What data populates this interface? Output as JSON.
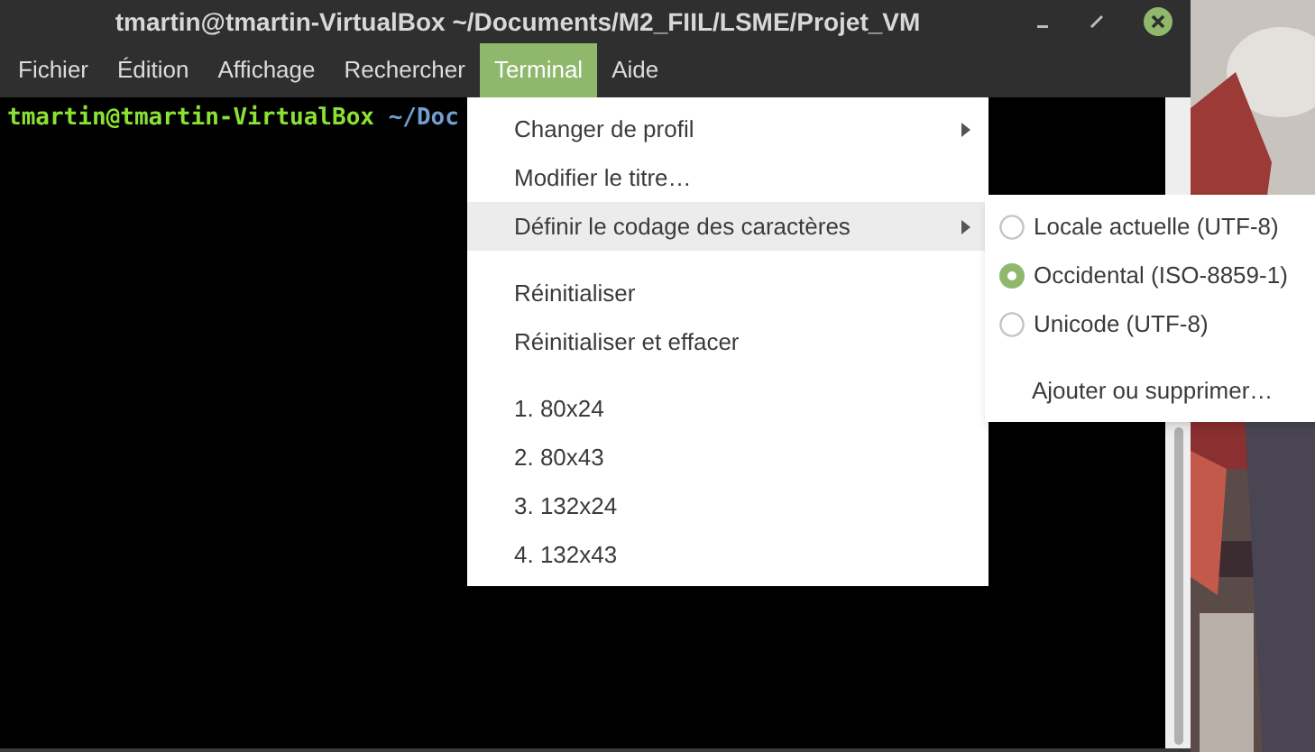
{
  "window": {
    "title": "tmartin@tmartin-VirtualBox ~/Documents/M2_FIIL/LSME/Projet_VM"
  },
  "menubar": [
    {
      "label": "Fichier",
      "selected": false
    },
    {
      "label": "Édition",
      "selected": false
    },
    {
      "label": "Affichage",
      "selected": false
    },
    {
      "label": "Rechercher",
      "selected": false
    },
    {
      "label": "Terminal",
      "selected": true
    },
    {
      "label": "Aide",
      "selected": false
    }
  ],
  "terminal": {
    "user": "tmartin@tmartin-VirtualBox",
    "path": "~/Doc"
  },
  "menu": {
    "items": [
      {
        "kind": "item",
        "label": "Changer de profil",
        "submenu": true,
        "highlighted": false
      },
      {
        "kind": "item",
        "label": "Modifier le titre…",
        "submenu": false,
        "highlighted": false
      },
      {
        "kind": "item",
        "label": "Définir le codage des caractères",
        "submenu": true,
        "highlighted": true
      },
      {
        "kind": "separator"
      },
      {
        "kind": "item",
        "label": "Réinitialiser",
        "submenu": false,
        "highlighted": false
      },
      {
        "kind": "item",
        "label": "Réinitialiser et effacer",
        "submenu": false,
        "highlighted": false
      },
      {
        "kind": "separator"
      },
      {
        "kind": "item",
        "label": "1. 80x24",
        "submenu": false,
        "highlighted": false
      },
      {
        "kind": "item",
        "label": "2. 80x43",
        "submenu": false,
        "highlighted": false
      },
      {
        "kind": "item",
        "label": "3. 132x24",
        "submenu": false,
        "highlighted": false
      },
      {
        "kind": "item",
        "label": "4. 132x43",
        "submenu": false,
        "highlighted": false
      }
    ]
  },
  "submenu": {
    "items": [
      {
        "kind": "radio",
        "label": "Locale actuelle (UTF-8)",
        "checked": false
      },
      {
        "kind": "radio",
        "label": "Occidental (ISO-8859-1)",
        "checked": true
      },
      {
        "kind": "radio",
        "label": "Unicode (UTF-8)",
        "checked": false
      },
      {
        "kind": "separator"
      },
      {
        "kind": "item",
        "label": "Ajouter ou supprimer…"
      }
    ]
  }
}
